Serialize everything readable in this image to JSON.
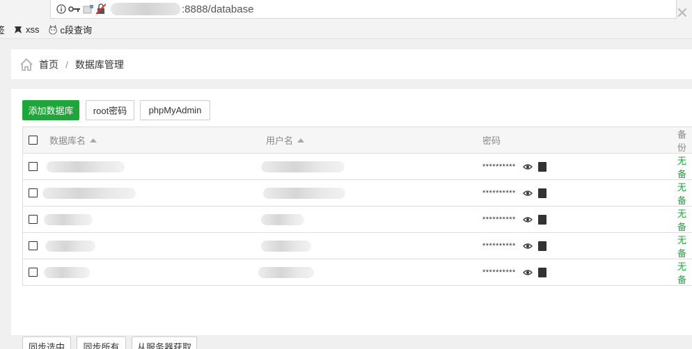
{
  "browser": {
    "url_suffix": ":8888/database",
    "bookmarks": [
      {
        "label": "签",
        "icon": "bookmark-partial-icon"
      },
      {
        "label": "xss",
        "icon": "xss-tool-icon"
      },
      {
        "label": "c段查询",
        "icon": "cat-icon"
      }
    ]
  },
  "breadcrumb": {
    "home": "首页",
    "separator": "/",
    "current": "数据库管理"
  },
  "toolbar": {
    "add_db": "添加数据库",
    "root_pwd": "root密码",
    "phpmyadmin": "phpMyAdmin"
  },
  "table": {
    "headers": {
      "db_name": "数据库名",
      "username": "用户名",
      "password": "密码",
      "backup": "备份"
    },
    "rows": [
      {
        "password": "**********",
        "backup": "无备"
      },
      {
        "password": "**********",
        "backup": "无备"
      },
      {
        "password": "**********",
        "backup": "无备"
      },
      {
        "password": "**********",
        "backup": "无备"
      },
      {
        "password": "**********",
        "backup": "无备"
      }
    ]
  },
  "footer_buttons": {
    "sync_selected": "同步选中",
    "sync_all": "同步所有",
    "fetch_server": "从服务器获取"
  },
  "colors": {
    "accent": "#20a53a"
  }
}
